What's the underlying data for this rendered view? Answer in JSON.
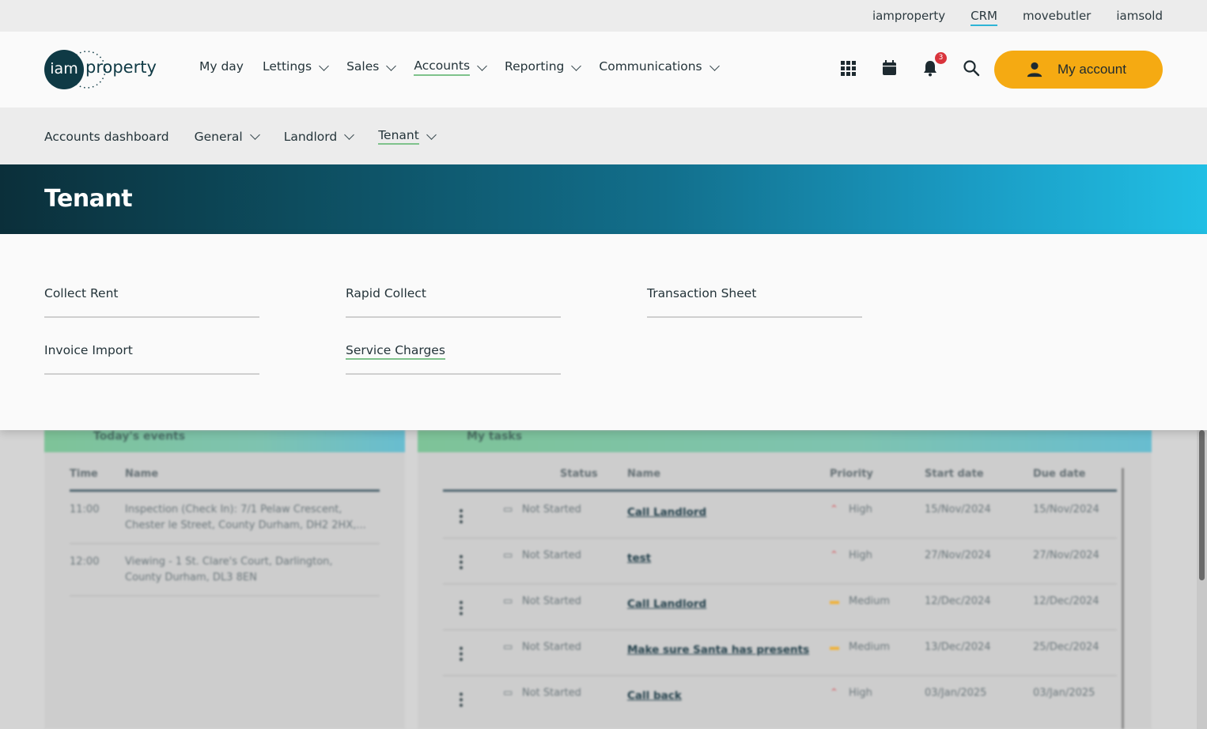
{
  "brands": [
    "iamproperty",
    "CRM",
    "movebutler",
    "iamsold"
  ],
  "logo": {
    "circle": "iam",
    "word": "property"
  },
  "nav": [
    {
      "label": "My day"
    },
    {
      "label": "Lettings"
    },
    {
      "label": "Sales"
    },
    {
      "label": "Accounts"
    },
    {
      "label": "Reporting"
    },
    {
      "label": "Communications"
    }
  ],
  "notification_count": "3",
  "my_account_label": "My account",
  "subnav": [
    {
      "label": "Accounts dashboard"
    },
    {
      "label": "General"
    },
    {
      "label": "Landlord"
    },
    {
      "label": "Tenant"
    }
  ],
  "banner_title": "Tenant",
  "tenant_links": [
    "Collect Rent",
    "Rapid Collect",
    "Transaction Sheet",
    "Invoice Import",
    "Service Charges"
  ],
  "events": {
    "title": "Today's events",
    "headers": [
      "Time",
      "Name"
    ],
    "rows": [
      {
        "time": "11:00",
        "name1": "Inspection (Check In): 7/1 Pelaw Crescent,",
        "name2": "Chester le Street, County Durham, DH2 2HX,..."
      },
      {
        "time": "12:00",
        "name1": "Viewing - 1 St. Clare's Court, Darlington,",
        "name2": "County Durham, DL3 8EN"
      }
    ]
  },
  "tasks": {
    "title": "My tasks",
    "headers": [
      "Status",
      "Name",
      "Priority",
      "Start date",
      "Due date"
    ],
    "rows": [
      {
        "status": "Not Started",
        "name": "Call Landlord",
        "priority": "High",
        "start": "15/Nov/2024",
        "due": "15/Nov/2024"
      },
      {
        "status": "Not Started",
        "name": "test",
        "priority": "High",
        "start": "27/Nov/2024",
        "due": "27/Nov/2024"
      },
      {
        "status": "Not Started",
        "name": "Call Landlord",
        "priority": "Medium",
        "start": "12/Dec/2024",
        "due": "12/Dec/2024"
      },
      {
        "status": "Not Started",
        "name": "Make sure Santa has presents",
        "priority": "Medium",
        "start": "13/Dec/2024",
        "due": "25/Dec/2024"
      },
      {
        "status": "Not Started",
        "name": "Call back",
        "priority": "High",
        "start": "03/Jan/2025",
        "due": "03/Jan/2025"
      }
    ]
  },
  "colors": {
    "accent": "#f5aa12",
    "active_underline": "#7fc28b",
    "crm_underline": "#2eb4d6",
    "high": "#d9343c",
    "medium": "#f0b23a"
  }
}
